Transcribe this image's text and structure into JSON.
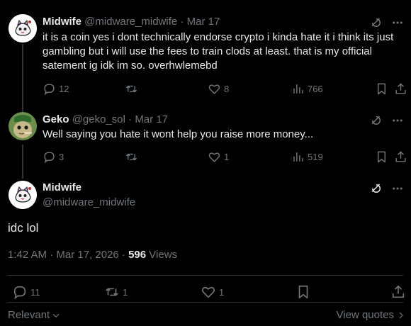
{
  "posts": [
    {
      "name": "Midwife",
      "handle": "@midware_midwife",
      "separator": "·",
      "date": "Mar 17",
      "text": "it is a coin yes i dont technically endorse crypto i kinda hate it i think its just gambling but i will use the fees to train clods at least. that is my official satement ig idk im so. overhwlemebd",
      "replies": "12",
      "reposts": "",
      "likes": "8",
      "views": "766"
    },
    {
      "name": "Geko",
      "handle": "@geko_sol",
      "separator": "·",
      "date": "Mar 17",
      "text": "Well saying you hate it wont help you raise more money...",
      "replies": "3",
      "reposts": "",
      "likes": "1",
      "views": "519"
    }
  ],
  "main_post": {
    "name": "Midwife",
    "handle": "@midware_midwife",
    "text": "idc lol",
    "timestamp": "1:42 AM · Mar 17, 2026 · ",
    "views_count": "596",
    "views_label": " Views",
    "replies": "11",
    "reposts": "1",
    "likes": "1"
  },
  "footer": {
    "sort_label": "Relevant",
    "view_quotes_label": "View quotes"
  },
  "icons": {
    "grok": "grok-icon",
    "more": "more-icon",
    "reply": "reply-icon",
    "repost": "repost-icon",
    "like": "heart-icon",
    "views": "views-icon",
    "bookmark": "bookmark-icon",
    "share": "share-icon"
  },
  "colors": {
    "background": "#000000",
    "text": "#e7e9ea",
    "muted": "#71767b",
    "divider": "#2f3336"
  }
}
